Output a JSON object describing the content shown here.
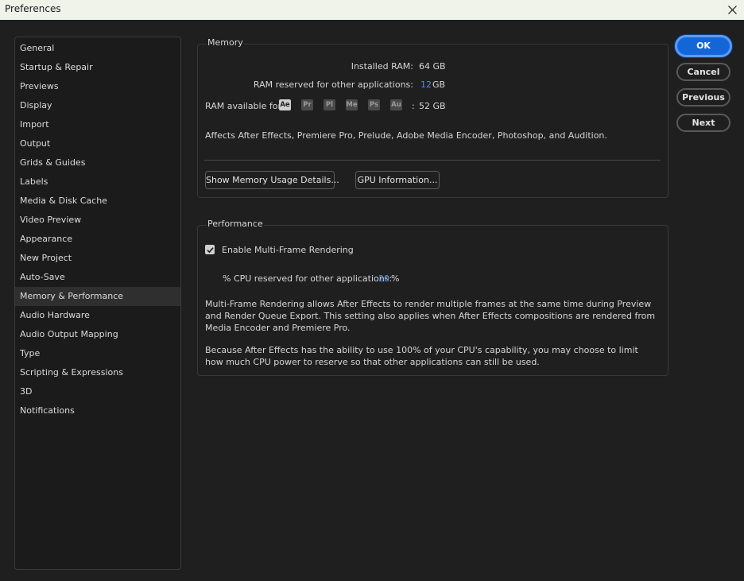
{
  "window": {
    "title": "Preferences"
  },
  "sidebar": {
    "items": [
      {
        "label": "General"
      },
      {
        "label": "Startup & Repair"
      },
      {
        "label": "Previews"
      },
      {
        "label": "Display"
      },
      {
        "label": "Import"
      },
      {
        "label": "Output"
      },
      {
        "label": "Grids & Guides"
      },
      {
        "label": "Labels"
      },
      {
        "label": "Media & Disk Cache"
      },
      {
        "label": "Video Preview"
      },
      {
        "label": "Appearance"
      },
      {
        "label": "New Project"
      },
      {
        "label": "Auto-Save"
      },
      {
        "label": "Memory & Performance",
        "active": true
      },
      {
        "label": "Audio Hardware"
      },
      {
        "label": "Audio Output Mapping"
      },
      {
        "label": "Type"
      },
      {
        "label": "Scripting & Expressions"
      },
      {
        "label": "3D"
      },
      {
        "label": "Notifications"
      }
    ]
  },
  "memory": {
    "title": "Memory",
    "installed_label": "Installed RAM:",
    "installed_value": "64 GB",
    "reserved_label": "RAM reserved for other applications:",
    "reserved_value": "12",
    "reserved_unit": "GB",
    "available_label": "RAM available for",
    "apps": [
      "Ae",
      "Pr",
      "Pl",
      "Me",
      "Ps",
      "Au"
    ],
    "available_sep": ":",
    "available_value": "52 GB",
    "affects_text": "Affects After Effects, Premiere Pro, Prelude, Adobe Media Encoder, Photoshop, and Audition.",
    "show_details_button": "Show Memory Usage Details...",
    "gpu_button": "GPU Information..."
  },
  "performance": {
    "title": "Performance",
    "mfr_label": "Enable Multi-Frame Rendering",
    "mfr_checked": true,
    "cpu_label": "% CPU reserved for other applications:",
    "cpu_value": "20",
    "cpu_unit": "%",
    "para1": "Multi-Frame Rendering allows After Effects to render multiple frames at the same time during Preview and Render Queue Export. This setting also applies when After Effects compositions are rendered from Media Encoder and Premiere Pro.",
    "para2": "Because After Effects has the ability to use 100% of your CPU's capability, you may choose to limit how much CPU power to reserve so that other applications can still be used."
  },
  "actions": {
    "ok": "OK",
    "cancel": "Cancel",
    "previous": "Previous",
    "next": "Next"
  },
  "colors": {
    "accent": "#1466d8",
    "value_blue": "#4d8fe3",
    "background": "#1f1f1f"
  },
  "icons": {
    "close": "close-icon",
    "checkbox": "checkmark-icon"
  }
}
